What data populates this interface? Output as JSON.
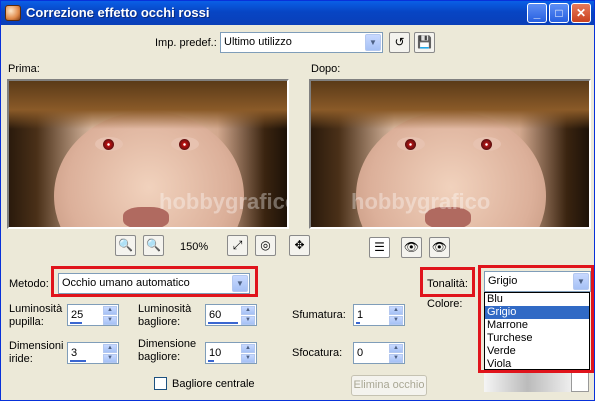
{
  "window": {
    "title": "Correzione effetto occhi rossi",
    "minimize": "_",
    "maximize": "□",
    "close": "✕"
  },
  "preset": {
    "label": "Imp. predef.:",
    "value": "Ultimo utilizzo"
  },
  "preview": {
    "before_label": "Prima:",
    "after_label": "Dopo:",
    "zoom": "150%",
    "watermark": "hobbygrafico"
  },
  "method": {
    "label": "Metodo:",
    "value": "Occhio umano automatico"
  },
  "hue": {
    "label": "Tonalità:",
    "value": "Grigio",
    "options": [
      "Blu",
      "Grigio",
      "Marrone",
      "Turchese",
      "Verde",
      "Viola"
    ],
    "selected_index": 1
  },
  "color": {
    "label": "Colore:"
  },
  "controls": {
    "pupil_luminosity": {
      "label1": "Luminosità",
      "label2": "pupilla:",
      "value": "25",
      "level": 0.25
    },
    "glare_luminosity": {
      "label1": "Luminosità",
      "label2": "bagliore:",
      "value": "60",
      "level": 0.6
    },
    "feather": {
      "label": "Sfumatura:",
      "value": "1",
      "level": 0.1
    },
    "iris_size": {
      "label1": "Dimensioni",
      "label2": "iride:",
      "value": "3",
      "level": 0.3
    },
    "glare_size": {
      "label1": "Dimensione",
      "label2": "bagliore:",
      "value": "10",
      "level": 0.1
    },
    "blur": {
      "label": "Sfocatura:",
      "value": "0",
      "level": 0.0
    }
  },
  "center_glare": {
    "label": "Bagliore centrale",
    "checked": false
  },
  "delete_eye_button": "Elimina occhio",
  "icons": {
    "zoom_in": "zoom-in-icon",
    "zoom_out": "zoom-out-icon",
    "fit": "fit-icon",
    "proof": "proof-icon",
    "pan": "pan-icon",
    "save": "save-icon",
    "reset": "reset-icon"
  }
}
